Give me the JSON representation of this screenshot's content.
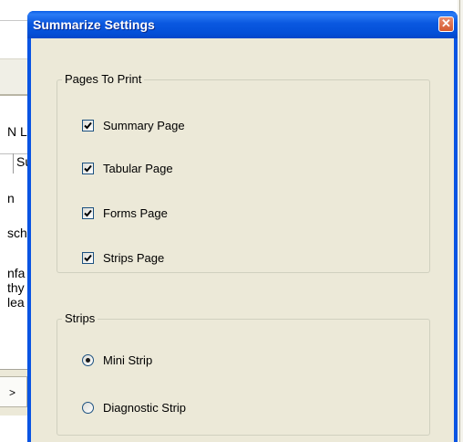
{
  "background_app": {
    "fragments": [
      "N L",
      "Su",
      "n",
      "sch",
      "nfa",
      "thy",
      "lea",
      ">"
    ]
  },
  "dialog": {
    "title": "Summarize Settings",
    "close_glyph": "✕",
    "pages_group": {
      "legend": "Pages To Print",
      "items": [
        {
          "label": "Summary Page",
          "checked": true
        },
        {
          "label": "Tabular Page",
          "checked": true
        },
        {
          "label": "Forms Page",
          "checked": true
        },
        {
          "label": "Strips Page",
          "checked": true
        }
      ]
    },
    "strips_group": {
      "legend": "Strips",
      "options": [
        {
          "label": "Mini Strip",
          "selected": true
        },
        {
          "label": "Diagnostic Strip",
          "selected": false
        }
      ]
    }
  },
  "colors": {
    "titlebar": "#0954e3",
    "client": "#ece9d8",
    "close": "#d45a30"
  }
}
